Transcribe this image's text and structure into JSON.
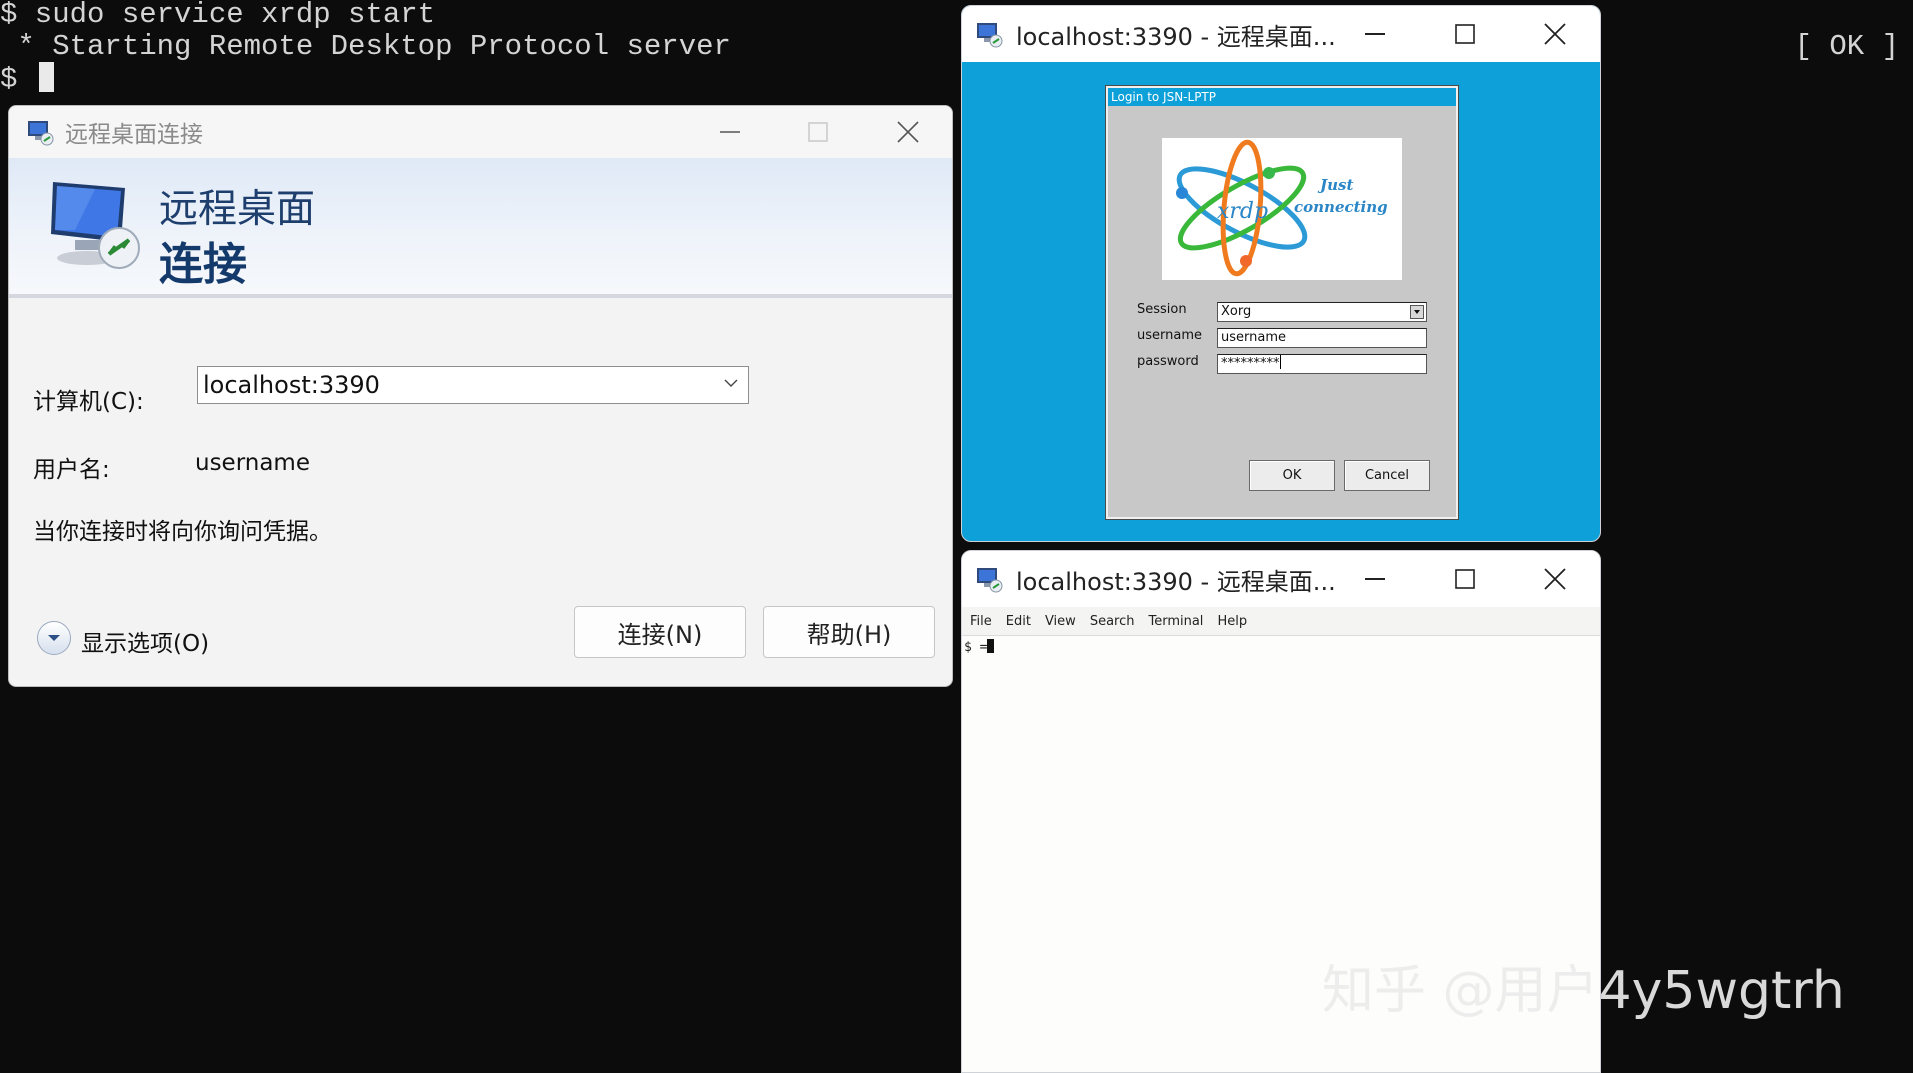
{
  "bg_terminal": {
    "line1": "$ sudo service xrdp start",
    "line2": " * Starting Remote Desktop Protocol server",
    "ok": "[ OK ]",
    "prompt": "$ "
  },
  "rdc": {
    "title": "远程桌面连接",
    "banner_line1": "远程桌面",
    "banner_line2": "连接",
    "computer_label": "计算机(C):",
    "computer_value": "localhost:3390",
    "user_label": "用户名:",
    "user_value": "username",
    "note": "当你连接时将向你询问凭据。",
    "show_options": "显示选项(O)",
    "connect_button": "连接(N)",
    "help_button": "帮助(H)"
  },
  "remote_window": {
    "title": "localhost:3390 - 远程桌面...",
    "login": {
      "title": "Login to JSN-LPTP",
      "logo_text": "xrdp",
      "logo_tagline_1": "Just",
      "logo_tagline_2": "connecting",
      "session_label": "Session",
      "session_value": "Xorg",
      "username_label": "username",
      "username_value": "username",
      "password_label": "password",
      "password_value": "*********",
      "ok_button": "OK",
      "cancel_button": "Cancel"
    }
  },
  "terminal_window": {
    "title": "localhost:3390 - 远程桌面...",
    "menu": [
      "File",
      "Edit",
      "View",
      "Search",
      "Terminal",
      "Help"
    ],
    "prompt": "$ ="
  },
  "watermark": "知乎 @用户4y5wgtrh",
  "colors": {
    "remote_bg": "#0ea0d8",
    "terminal_bg": "#0c0c0c",
    "banner_text": "#143a6b"
  }
}
